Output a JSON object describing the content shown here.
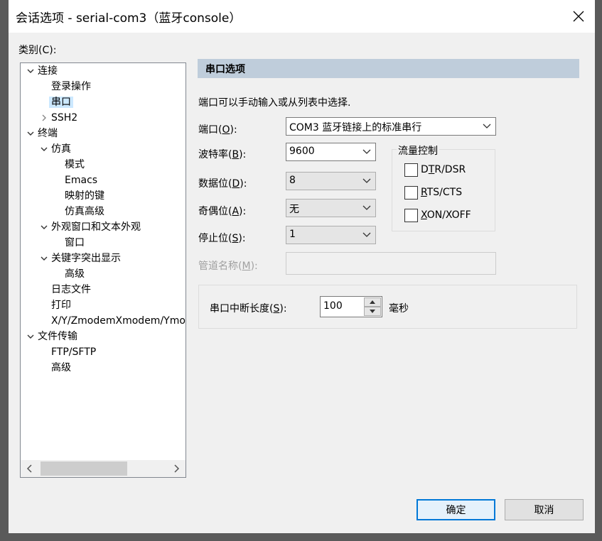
{
  "window": {
    "title": "会话选项 - serial-com3（蓝牙console）"
  },
  "category": {
    "label": "类别(C):"
  },
  "tree": [
    {
      "label": "连接",
      "expand": "down"
    },
    {
      "label": "登录操作"
    },
    {
      "label": "串口",
      "selected": true
    },
    {
      "label": "SSH2",
      "expand": "right"
    },
    {
      "label": "终端",
      "expand": "down"
    },
    {
      "label": "仿真",
      "expand": "down"
    },
    {
      "label": "模式"
    },
    {
      "label": "Emacs"
    },
    {
      "label": "映射的键"
    },
    {
      "label": "仿真高级"
    },
    {
      "label": "外观窗口和文本外观",
      "expand": "down"
    },
    {
      "label": "窗口"
    },
    {
      "label": "关键字突出显示",
      "expand": "down"
    },
    {
      "label": "高级"
    },
    {
      "label": "日志文件"
    },
    {
      "label": "打印"
    },
    {
      "label": "X/Y/ZmodemXmodem/Ymodem"
    },
    {
      "label": "文件传输",
      "expand": "down"
    },
    {
      "label": "FTP/SFTP"
    },
    {
      "label": "高级"
    }
  ],
  "panel": {
    "header": "串口选项",
    "hint": "端口可以手动输入或从列表中选择.",
    "port_label": "端口(O):",
    "port_value": "COM3 蓝牙链接上的标准串行",
    "baud_label": "波特率(B):",
    "baud_value": "9600",
    "databits_label": "数据位(D):",
    "databits_value": "8",
    "parity_label": "奇偶位(A):",
    "parity_value": "无",
    "stopbits_label": "停止位(S):",
    "stopbits_value": "1",
    "pipe_label": "管道名称(M):",
    "pipe_value": "",
    "flow": {
      "title": "流量控制",
      "dtr": "DTR/DSR",
      "rts": "RTS/CTS",
      "xon": "XON/XOFF"
    },
    "break_label": "串口中断长度(S):",
    "break_value": "100",
    "break_unit": "毫秒"
  },
  "buttons": {
    "ok": "确定",
    "cancel": "取消"
  }
}
